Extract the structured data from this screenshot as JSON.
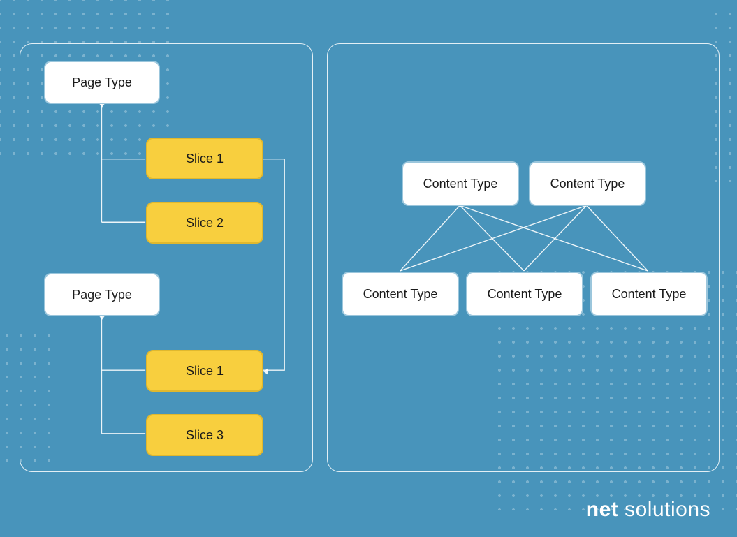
{
  "left_panel": {
    "tree1": {
      "root": "Page Type",
      "children": [
        {
          "label": "Slice 1"
        },
        {
          "label": "Slice 2"
        }
      ]
    },
    "tree2": {
      "root": "Page Type",
      "children": [
        {
          "label": "Slice 1"
        },
        {
          "label": "Slice 3"
        }
      ]
    }
  },
  "right_panel": {
    "top_row": [
      {
        "label": "Content Type"
      },
      {
        "label": "Content Type"
      }
    ],
    "bottom_row": [
      {
        "label": "Content Type"
      },
      {
        "label": "Content Type"
      },
      {
        "label": "Content Type"
      }
    ]
  },
  "brand": {
    "part1": "net",
    "part2": "solutions"
  },
  "colors": {
    "background": "#4894BB",
    "node_white_bg": "#ffffff",
    "node_white_border": "#9BC6DC",
    "node_yellow_bg": "#F8CF3E",
    "node_yellow_border": "#E0B82E",
    "connector": "rgba(255,255,255,0.9)"
  }
}
